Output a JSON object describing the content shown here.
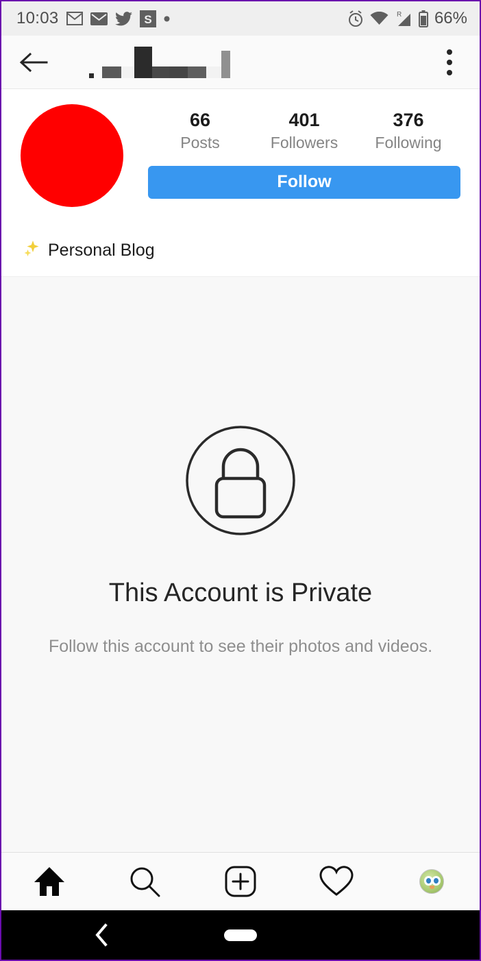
{
  "status_bar": {
    "time": "10:03",
    "battery_percent": "66%",
    "icons": [
      "gmail-icon",
      "email-icon",
      "twitter-icon",
      "s-app-icon",
      "dot-icon"
    ],
    "right_icons": [
      "alarm-icon",
      "wifi-icon",
      "signal-roaming-icon",
      "battery-icon"
    ],
    "roaming_label": "R",
    "background": "#efefef"
  },
  "app_bar": {
    "back_label": "back-arrow",
    "title_redacted": true,
    "overflow_label": "more-options"
  },
  "profile": {
    "avatar_color": "#ff0000",
    "stats": [
      {
        "value": "66",
        "label": "Posts"
      },
      {
        "value": "401",
        "label": "Followers"
      },
      {
        "value": "376",
        "label": "Following"
      }
    ],
    "follow_button": "Follow",
    "follow_color": "#3897f0",
    "bio_emoji": "✨",
    "bio_text": "Personal Blog"
  },
  "private_notice": {
    "icon": "lock-icon",
    "title": "This Account is Private",
    "subtitle": "Follow this account to see their photos and videos."
  },
  "tab_bar": {
    "tabs": [
      {
        "name": "home",
        "active": true
      },
      {
        "name": "search",
        "active": false
      },
      {
        "name": "add-post",
        "active": false
      },
      {
        "name": "activity",
        "active": false
      },
      {
        "name": "profile",
        "active": false
      }
    ]
  },
  "android_nav": {
    "back": "back-gesture",
    "home": "home-pill"
  }
}
